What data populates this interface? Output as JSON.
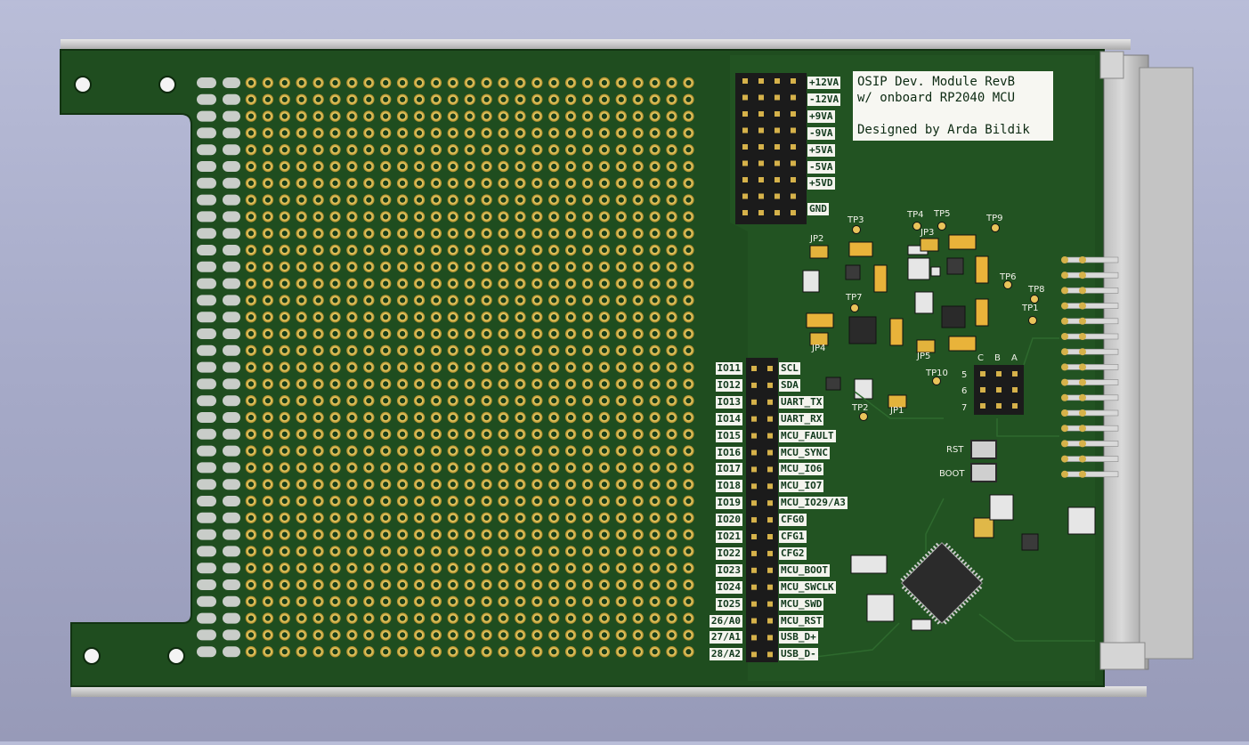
{
  "board": {
    "title_lines": [
      "OSIP Dev. Module RevB",
      "w/ onboard RP2040 MCU",
      "",
      "Designed by Arda Bildik"
    ]
  },
  "power_labels": [
    "+12VA",
    "-12VA",
    "+9VA",
    "-9VA",
    "+5VA",
    "-5VA",
    "+5VD",
    "GND"
  ],
  "io_left_labels": [
    "IO11",
    "IO12",
    "IO13",
    "IO14",
    "IO15",
    "IO16",
    "IO17",
    "IO18",
    "IO19",
    "IO20",
    "IO21",
    "IO22",
    "IO23",
    "IO24",
    "IO25",
    "26/A0",
    "27/A1",
    "28/A2"
  ],
  "io_right_labels": [
    "SCL",
    "SDA",
    "UART_TX",
    "UART_RX",
    "MCU_FAULT",
    "MCU_SYNC",
    "MCU_IO6",
    "MCU_IO7",
    "MCU_IO29/A3",
    "CFG0",
    "CFG1",
    "CFG2",
    "MCU_BOOT",
    "MCU_SWCLK",
    "MCU_SWD",
    "MCU_RST",
    "USB_D+",
    "USB_D-"
  ],
  "refdes": {
    "tp1": "TP1",
    "tp2": "TP2",
    "tp3": "TP3",
    "tp4": "TP4",
    "tp5": "TP5",
    "tp6": "TP6",
    "tp7": "TP7",
    "tp8": "TP8",
    "tp9": "TP9",
    "tp10": "TP10",
    "jp1": "JP1",
    "jp2": "JP2",
    "jp3": "JP3",
    "jp4": "JP4",
    "jp5": "JP5",
    "rst": "RST",
    "boot": "BOOT",
    "col_c": "C",
    "col_b": "B",
    "col_a": "A",
    "row_5": "5",
    "row_6": "6",
    "row_7": "7"
  },
  "colors": {
    "pcb_green": "#1f4d1f",
    "pcb_dark": "#173d17",
    "rail_gray": "#c9c9c9",
    "gold_pad": "#d9b84a",
    "silk": "#f2f2ea",
    "ic_black": "#2a2a2a"
  }
}
